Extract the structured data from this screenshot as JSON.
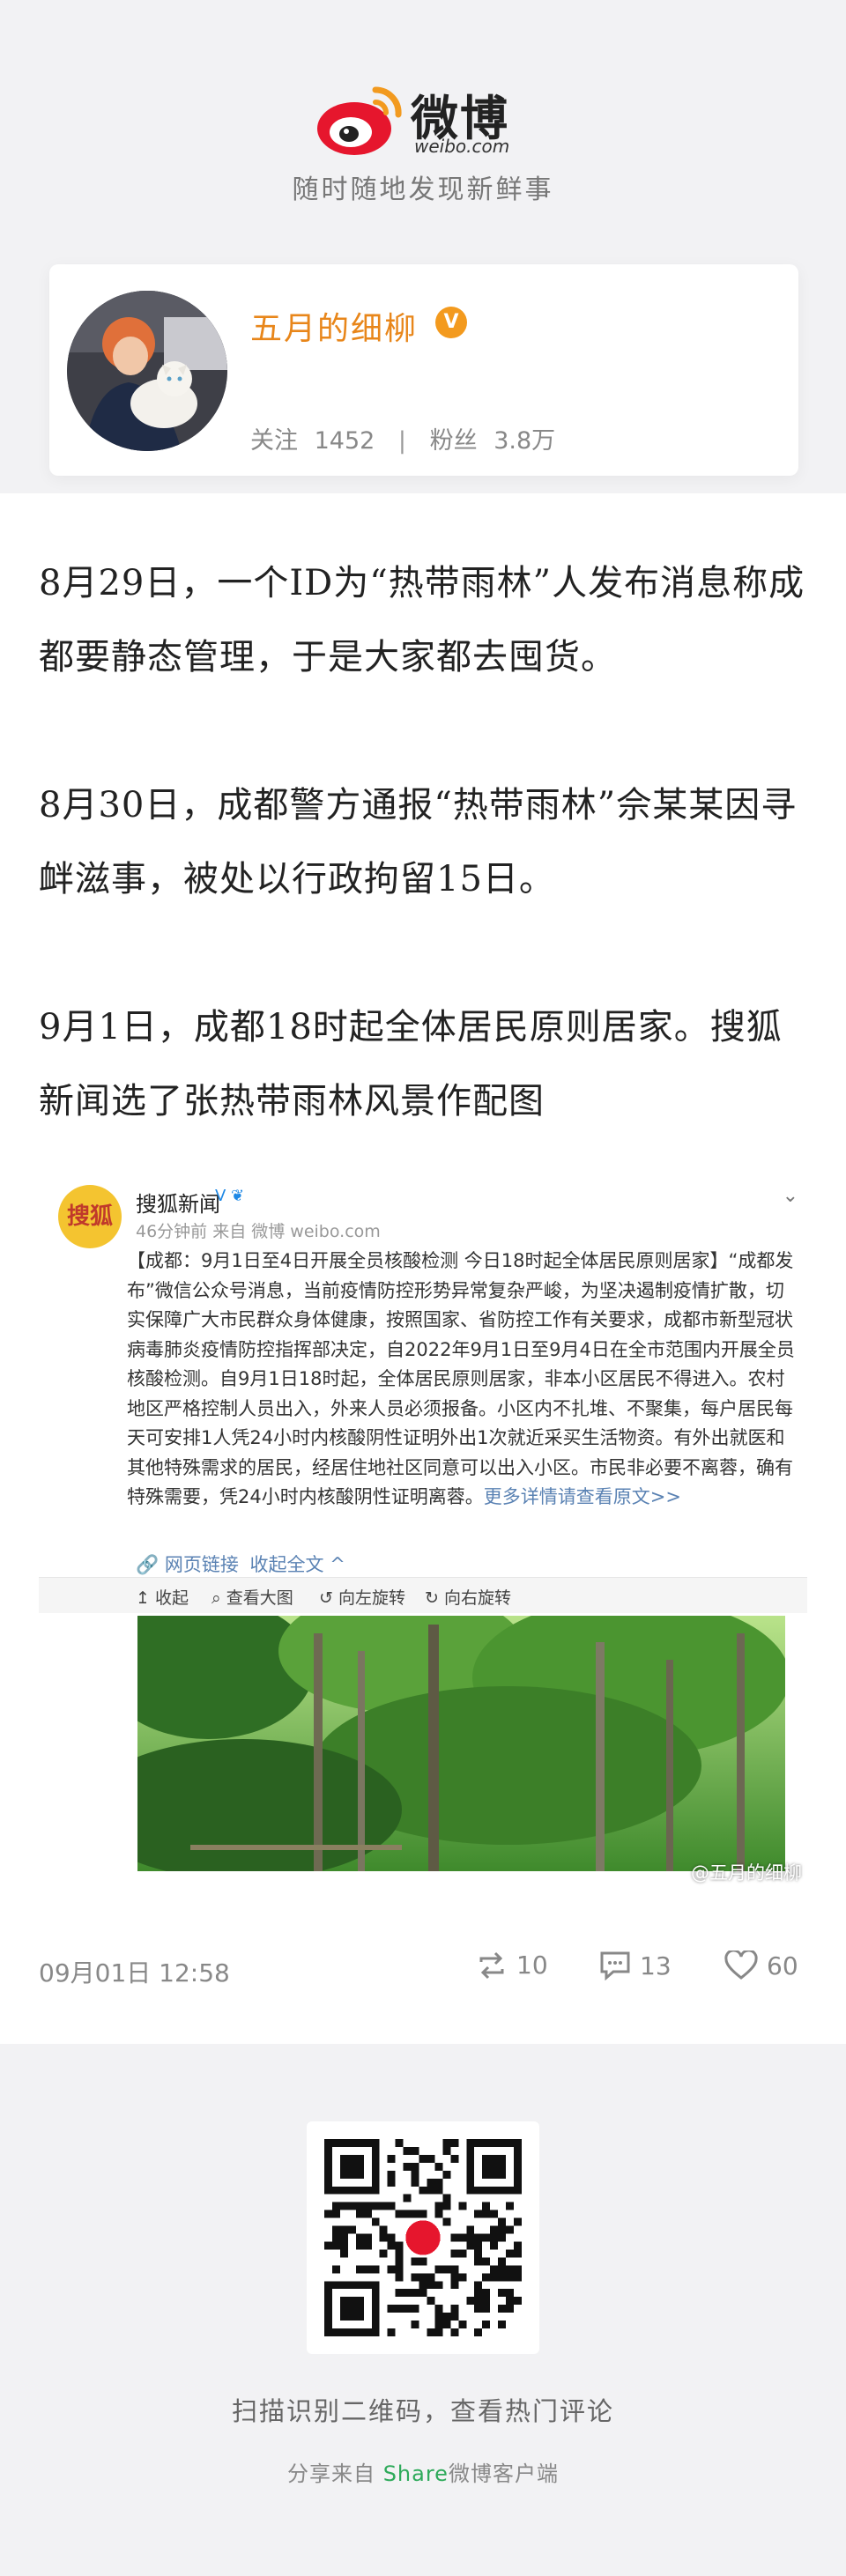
{
  "header": {
    "logo_wordmark": "微博",
    "logo_domain": "weibo.com",
    "tagline": "随时随地发现新鲜事"
  },
  "profile": {
    "username": "五月的细柳",
    "verified_label": "V",
    "following_label": "关注",
    "following_count": "1452",
    "separator": "|",
    "fans_label": "粉丝",
    "fans_count": "3.8万"
  },
  "post": {
    "paragraphs": [
      "8月29日，一个ID为“热带雨林”人发布消息称成都要静态管理，于是大家都去囤货。",
      "8月30日，成都警方通报“热带雨林”佘某某因寻衅滋事，被处以行政拘留15日。",
      "9月1日，成都18时起全体居民原则居家。搜狐新闻选了张热带雨林风景作配图"
    ],
    "datetime": "09月01日 12:58",
    "repost_count": "10",
    "comment_count": "13",
    "like_count": "60"
  },
  "embedded_post": {
    "avatar_text": "搜狐",
    "author": "搜狐新闻",
    "badges": "V ❦",
    "meta": "46分钟前 来自 微博 weibo.com",
    "body": "【成都：9月1日至4日开展全员核酸检测 今日18时起全体居民原则居家】“成都发布”微信公众号消息，当前疫情防控形势异常复杂严峻，为坚决遏制疫情扩散，切实保障广大市民群众身体健康，按照国家、省防控工作有关要求，成都市新型冠状病毒肺炎疫情防控指挥部决定，自2022年9月1日至9月4日在全市范围内开展全员核酸检测。自9月1日18时起，全体居民原则居家，非本小区居民不得进入。农村地区严格控制人员出入，外来人员必须报备。小区内不扎堆、不聚集，每户居民每天可安排1人凭24小时内核酸阴性证明外出1次就近采买生活物资。有外出就医和其他特殊需求的居民，经居住地社区同意可以出入小区。市民非必要不离蓉，确有特殊需要，凭24小时内核酸阴性证明离蓉。",
    "more_text": "更多详情请查看原文>>",
    "link_text": "网页链接",
    "collapse_text": "收起全文 ^",
    "toolbar": {
      "collapse": "收起",
      "view_large": "查看大图",
      "rotate_left": "向左旋转",
      "rotate_right": "向右旋转"
    },
    "watermark": "@五月的细柳"
  },
  "footer": {
    "scan_hint": "扫描识别二维码，查看热门评论",
    "share_prefix": "分享来自",
    "share_brand": "Share",
    "share_suffix": "微博客户端"
  },
  "colors": {
    "accent_orange": "#e8861a",
    "weibo_red": "#e6162d",
    "link_blue": "#5a82b3",
    "share_green": "#2eaa5a"
  }
}
